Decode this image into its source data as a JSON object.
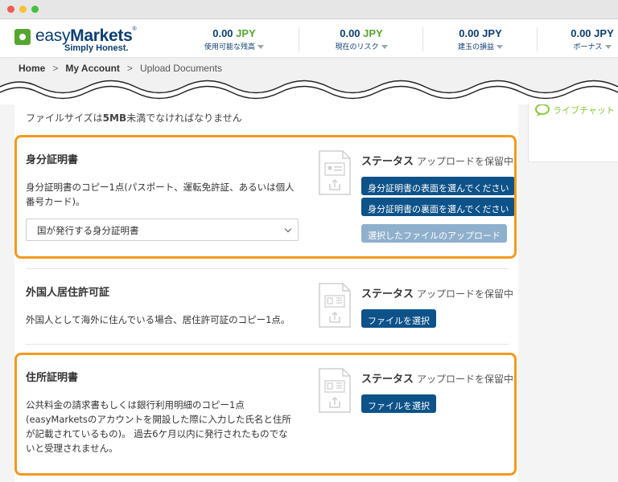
{
  "brand": {
    "name_light": "easy",
    "name_bold": "Markets",
    "registered": "®",
    "tagline": "Simply Honest.",
    "accent_green": "#55a630",
    "navy": "#0b3e71"
  },
  "header": {
    "metrics": [
      {
        "amount": "0.00",
        "currency": "JPY",
        "label": "使用可能な残高"
      },
      {
        "amount": "0.00",
        "currency": "JPY",
        "label": "現在のリスク"
      },
      {
        "amount": "0.00",
        "currency": "JPY",
        "label": "建玉の損益"
      },
      {
        "amount": "0.00",
        "currency": "JPY",
        "label": "ボーナス"
      }
    ]
  },
  "breadcrumb": {
    "items": [
      "Home",
      "My Account",
      "Upload Documents"
    ],
    "separator": ">"
  },
  "sidebar": {
    "chat_label": "ライブチャット"
  },
  "notice": {
    "prefix": "ファイルサイズは",
    "size": "5MB",
    "suffix": "未満でなければなりません"
  },
  "sections": [
    {
      "title": "身分証明書",
      "description": "身分証明書のコピー1点(パスポート、運転免許証、あるいは個人番号カード)。",
      "select_value": "国が発行する身分証明書",
      "status_label": "ステータス",
      "status_value": "アップロードを保留中",
      "buttons": [
        "身分証明書の表面を選んでください",
        "身分証明書の裏面を選んでください",
        "選択したファイルのアップロード"
      ]
    },
    {
      "title": "外国人居住許可証",
      "description": "外国人として海外に住んでいる場合、居住許可証のコピー1点。",
      "status_label": "ステータス",
      "status_value": "アップロードを保留中",
      "buttons": [
        "ファイルを選択"
      ]
    },
    {
      "title": "住所証明書",
      "description_lines": [
        "公共料金の請求書もしくは銀行利用明細のコピー1点",
        "(easyMarketsのアカウントを開設した際に入力した氏名と住所",
        "が記載されているもの)。 過去6ケ月以内に発行されたものでな",
        "いと受理されません。"
      ],
      "status_label": "ステータス",
      "status_value": "アップロードを保留中",
      "buttons": [
        "ファイルを選択"
      ]
    }
  ],
  "colors": {
    "highlight": "#f39a1e",
    "button": "#0d5289",
    "button_disabled": "#8fb0cc"
  }
}
